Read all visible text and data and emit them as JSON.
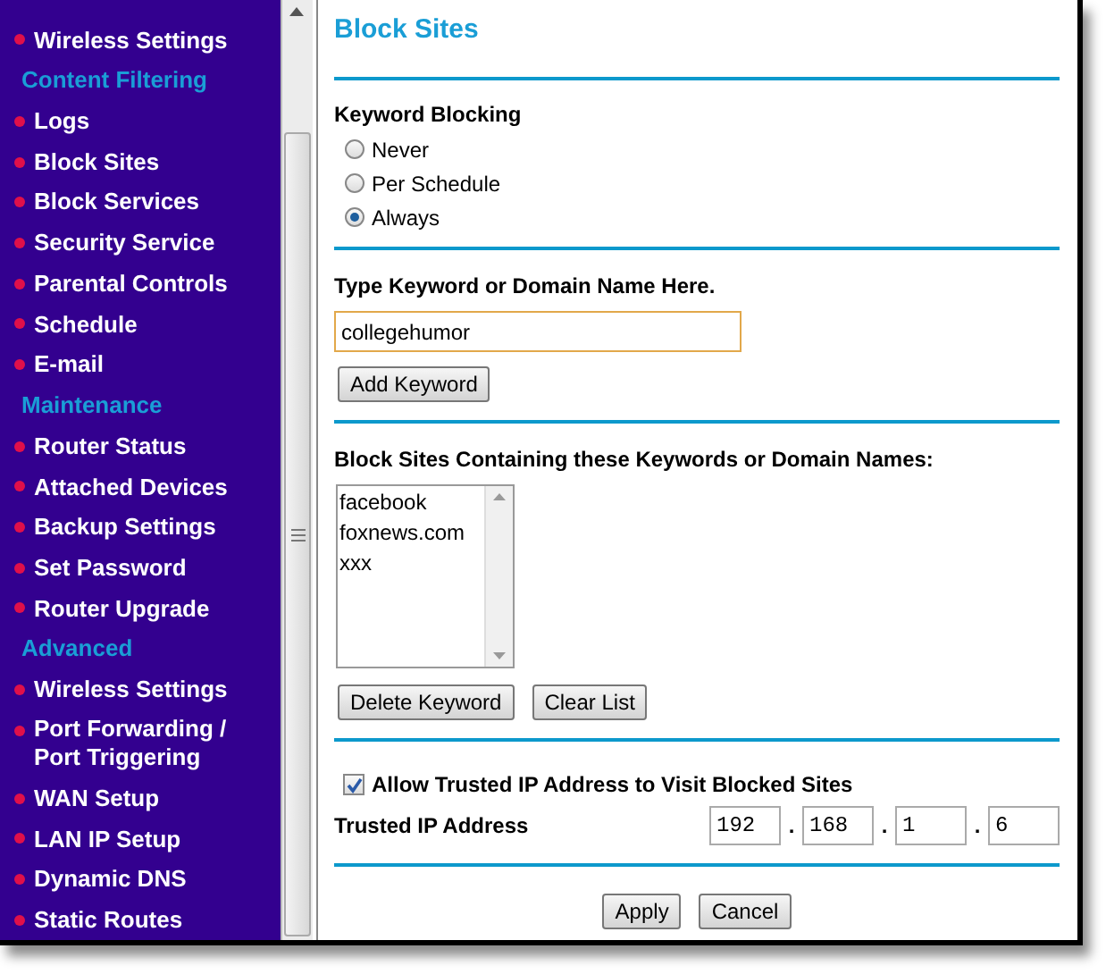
{
  "sidebar": {
    "items": [
      {
        "kind": "link",
        "label": "Wireless Settings"
      },
      {
        "kind": "header",
        "label": "Content Filtering"
      },
      {
        "kind": "link",
        "label": "Logs"
      },
      {
        "kind": "link",
        "label": "Block Sites"
      },
      {
        "kind": "link",
        "label": "Block Services"
      },
      {
        "kind": "link",
        "label": "Security Service"
      },
      {
        "kind": "link",
        "label": "Parental Controls"
      },
      {
        "kind": "link",
        "label": "Schedule"
      },
      {
        "kind": "link",
        "label": "E-mail"
      },
      {
        "kind": "header",
        "label": "Maintenance"
      },
      {
        "kind": "link",
        "label": "Router Status"
      },
      {
        "kind": "link",
        "label": "Attached Devices"
      },
      {
        "kind": "link",
        "label": "Backup Settings"
      },
      {
        "kind": "link",
        "label": "Set Password"
      },
      {
        "kind": "link",
        "label": "Router Upgrade"
      },
      {
        "kind": "header",
        "label": "Advanced"
      },
      {
        "kind": "link",
        "label": "Wireless Settings"
      },
      {
        "kind": "link",
        "label": "Port Forwarding / Port Triggering"
      },
      {
        "kind": "link",
        "label": "WAN Setup"
      },
      {
        "kind": "link",
        "label": "LAN IP Setup"
      },
      {
        "kind": "link",
        "label": "Dynamic DNS"
      },
      {
        "kind": "link",
        "label": "Static Routes"
      }
    ]
  },
  "page": {
    "title": "Block Sites",
    "keyword_blocking": {
      "label": "Keyword Blocking",
      "options": [
        {
          "label": "Never",
          "selected": false
        },
        {
          "label": "Per Schedule",
          "selected": false
        },
        {
          "label": "Always",
          "selected": true
        }
      ]
    },
    "keyword_entry": {
      "label": "Type Keyword or Domain Name Here.",
      "value": "collegehumor",
      "button": "Add Keyword"
    },
    "blocked_list": {
      "label": "Block Sites Containing these Keywords or Domain Names:",
      "items": [
        "facebook",
        "foxnews.com",
        "xxx"
      ],
      "buttons": [
        "Delete Keyword",
        "Clear List"
      ]
    },
    "trusted": {
      "label": "Allow Trusted IP Address to Visit Blocked Sites",
      "checked": true,
      "ip_label": "Trusted IP Address",
      "ip": [
        "192",
        "168",
        "1",
        "6"
      ],
      "ip_separators": [
        ".",
        ".",
        "."
      ]
    },
    "buttons": [
      "Apply",
      "Cancel"
    ]
  }
}
